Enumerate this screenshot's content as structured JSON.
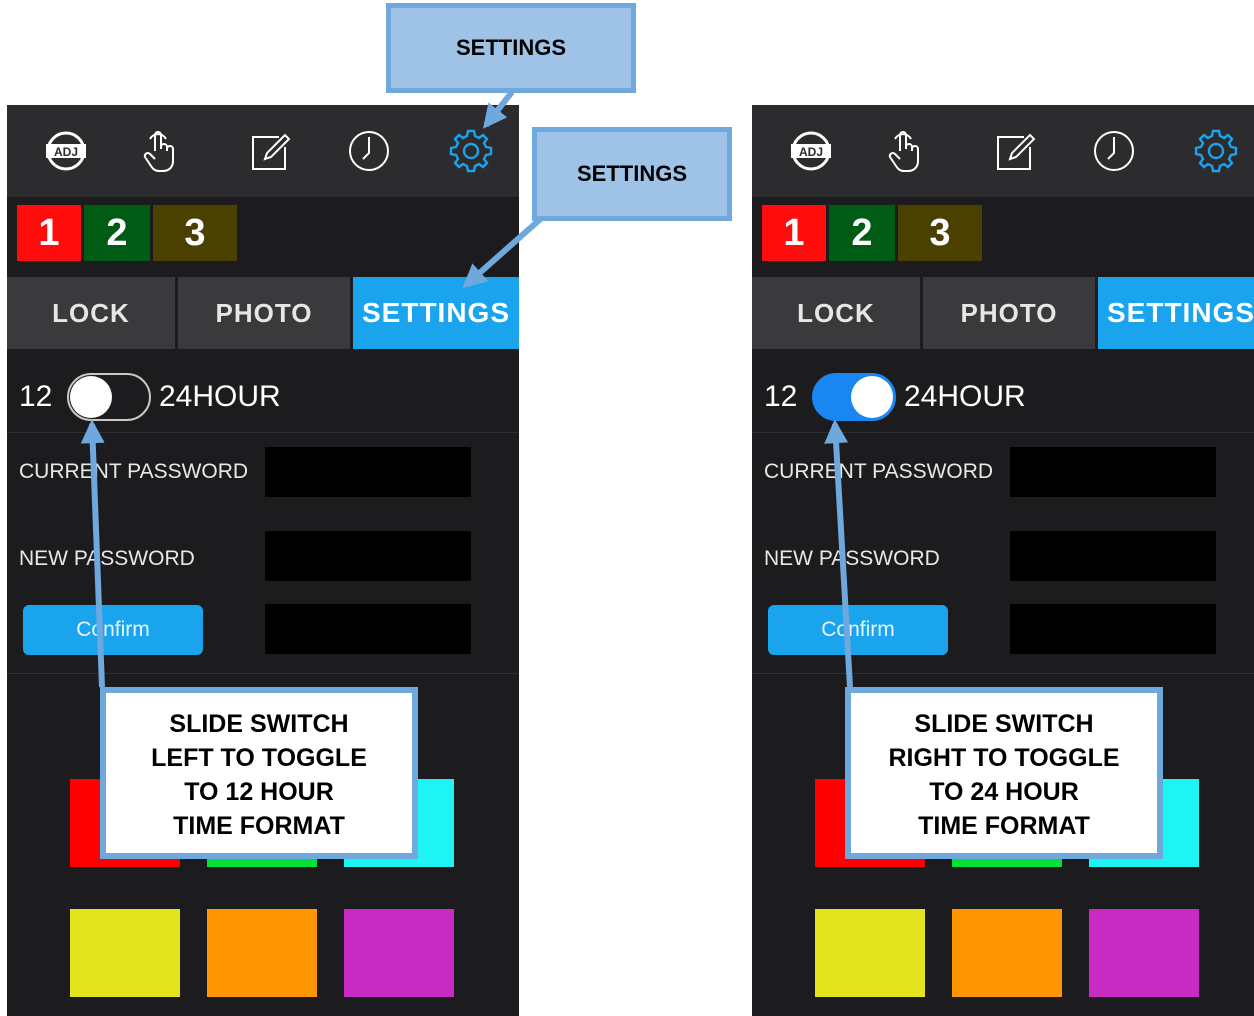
{
  "chips": [
    "1",
    "2",
    "3"
  ],
  "tabs": {
    "lock": "LOCK",
    "photo": "PHOTO",
    "settings": "SETTINGS"
  },
  "hour_toggle": {
    "left_label": "12",
    "right_label": "24HOUR"
  },
  "fields": {
    "current_password": "CURRENT PASSWORD",
    "new_password": "NEW PASSWORD",
    "confirm": "Confirm"
  },
  "screens": [
    {
      "toggle_state": "off (12 hour)"
    },
    {
      "toggle_state": "on (24 hour)"
    }
  ],
  "swatches": {
    "row1": [
      "#ff0000",
      "#00e038",
      "#1ef4f4"
    ],
    "row2": [
      "#e3e31e",
      "#ff9500",
      "#c72bc2"
    ]
  },
  "callouts": {
    "top": "SETTINGS",
    "middle": "SETTINGS",
    "left": [
      "SLIDE SWITCH",
      "LEFT TO TOGGLE",
      "TO 12 HOUR",
      "TIME FORMAT"
    ],
    "right": [
      "SLIDE SWITCH",
      "RIGHT TO TOGGLE",
      "TO 24 HOUR",
      "TIME FORMAT"
    ]
  },
  "colors": {
    "accent": "#1aa4ee",
    "callout_border": "#6fa8dc",
    "callout_fill": "#9fc3e7",
    "toggle_on": "#1a86f2"
  }
}
